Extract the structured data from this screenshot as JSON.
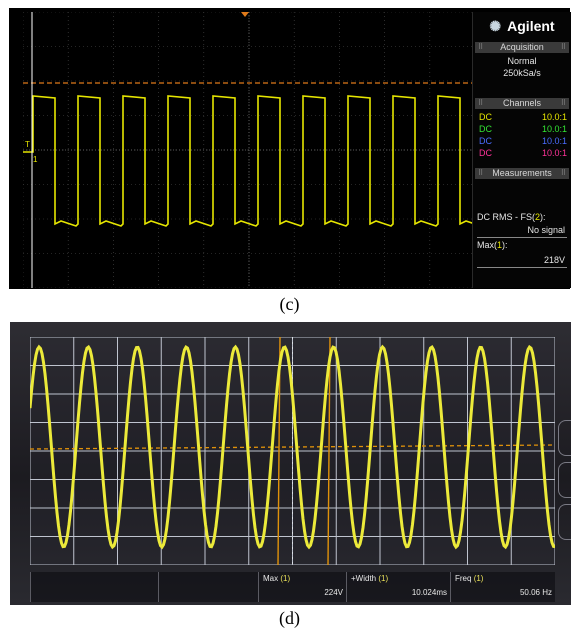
{
  "panel_c": {
    "caption": "(c)",
    "brand": "Agilent",
    "acquisition": {
      "header": "Acquisition",
      "mode": "Normal",
      "rate": "250kSa/s"
    },
    "channels": {
      "header": "Channels",
      "rows": [
        {
          "coupling": "DC",
          "probe": "10.0:1",
          "color": "#e6e600"
        },
        {
          "coupling": "DC",
          "probe": "10.0:1",
          "color": "#33e633"
        },
        {
          "coupling": "DC",
          "probe": "10.0:1",
          "color": "#4a6cff"
        },
        {
          "coupling": "DC",
          "probe": "10.0:1",
          "color": "#ff3399"
        }
      ]
    },
    "measurements": {
      "header": "Measurements",
      "items": [
        {
          "name": "DC RMS - FS(",
          "src": "2",
          "close": "):",
          "value": "No signal"
        },
        {
          "name": "Max(",
          "src": "1",
          "close": "):",
          "value": "218V"
        }
      ]
    },
    "markers": {
      "trigger": "T",
      "channel": "1"
    },
    "colors": {
      "trace": "#e6e600",
      "grid": "#5a5a5a",
      "trigger_line": "#e07a1a"
    }
  },
  "panel_d": {
    "caption": "(d)",
    "measurements": [
      {
        "name": "Max",
        "src": "(1)",
        "value": "224V"
      },
      {
        "name": "+Width",
        "src": "(1)",
        "value": "10.024ms"
      },
      {
        "name": "Freq",
        "src": "(1)",
        "value": "50.06 Hz"
      }
    ],
    "colors": {
      "trace": "#ecea3a",
      "grid": "#cfd3dc",
      "cursor": "#e0920a"
    }
  }
}
